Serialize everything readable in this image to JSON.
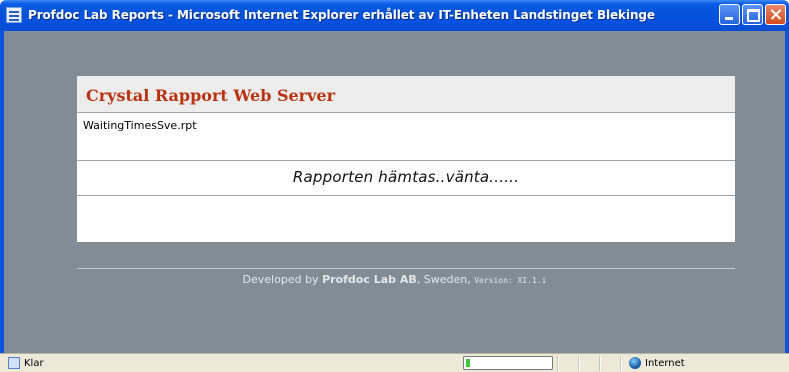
{
  "window": {
    "title": "Profdoc Lab Reports - Microsoft Internet Explorer erhållet av IT-Enheten Landstinget Blekinge",
    "icon": "ie-page-icon"
  },
  "panel": {
    "title": "Crystal Rapport Web Server",
    "file_name": "WaitingTimesSve.rpt",
    "loading_text": "Rapporten hämtas..vänta......"
  },
  "footer": {
    "prefix": "Developed by",
    "company": "Profdoc Lab AB",
    "suffix": ", Sweden,",
    "version": "Version: XI.1.i"
  },
  "statusbar": {
    "status": "Klar",
    "progress": 0.05,
    "zone": "Internet"
  },
  "colors": {
    "titlebar": "#0453d8",
    "content_bg": "#818c95",
    "panel_title": "#b8320f",
    "progress_fill": "#3fc83a"
  }
}
